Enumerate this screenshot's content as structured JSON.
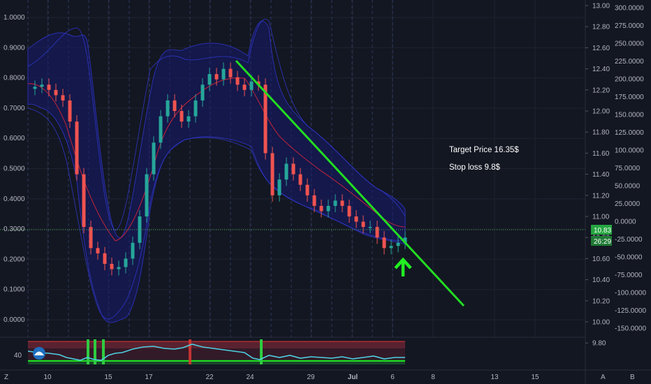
{
  "chart_data": {
    "type": "candlestick",
    "left_axis": {
      "ticks": [
        "1.0000",
        "0.9000",
        "0.8000",
        "0.7000",
        "0.6000",
        "0.5000",
        "0.4000",
        "0.3000",
        "0.2000",
        "0.1000",
        "0.0000"
      ],
      "min": 0.0,
      "max": 1.0
    },
    "price_axis": {
      "ticks": [
        "13.00",
        "12.80",
        "12.60",
        "12.40",
        "12.20",
        "12.00",
        "11.80",
        "11.60",
        "11.40",
        "11.20",
        "11.00",
        "10.80",
        "10.60",
        "10.40",
        "10.20",
        "10.00",
        "9.80"
      ],
      "min": 9.8,
      "max": 13.0
    },
    "osc_axis": {
      "ticks": [
        "300.0000",
        "275.0000",
        "250.0000",
        "225.0000",
        "200.0000",
        "175.0000",
        "150.0000",
        "125.0000",
        "100.0000",
        "75.0000",
        "50.0000",
        "25.0000",
        "0.0000",
        "-25.0000",
        "-50.0000",
        "-75.0000",
        "-100.0000",
        "-125.0000",
        "-150.0000"
      ]
    },
    "x_ticks": [
      "10",
      "15",
      "17",
      "22",
      "24",
      "29",
      "Jul",
      "6",
      "8",
      "13",
      "15"
    ],
    "price_series": [
      12.21,
      12.23,
      12.25,
      12.2,
      12.15,
      12.1,
      11.9,
      11.4,
      10.9,
      10.7,
      10.65,
      10.55,
      10.5,
      10.52,
      10.6,
      10.75,
      11.0,
      11.4,
      11.7,
      11.95,
      12.1,
      12.0,
      11.9,
      11.95,
      12.1,
      12.25,
      12.35,
      12.3,
      12.4,
      12.32,
      12.25,
      12.2,
      12.28,
      12.25,
      11.6,
      11.2,
      11.35,
      11.5,
      11.4,
      11.3,
      11.2,
      11.1,
      11.05,
      11.1,
      11.15,
      11.1,
      11.0,
      10.95,
      10.9,
      10.9,
      10.8,
      10.7,
      10.72,
      10.75,
      10.8
    ],
    "current_price": "10.83",
    "countdown": "26:29",
    "osc_label": "40",
    "annotations": {
      "target": "Target Price 16.35$",
      "stop": "Stop loss 9.8$"
    },
    "colors": {
      "up": "#26a69a",
      "down": "#ef5350",
      "trendline": "#22dd22",
      "band": "#1e22aa",
      "price_line": "#4caf50",
      "osc_line": "#4dd0e1"
    }
  },
  "toolbar": {
    "bottom_left": "Z",
    "bottom_right_a": "A",
    "bottom_right_b": "B"
  }
}
